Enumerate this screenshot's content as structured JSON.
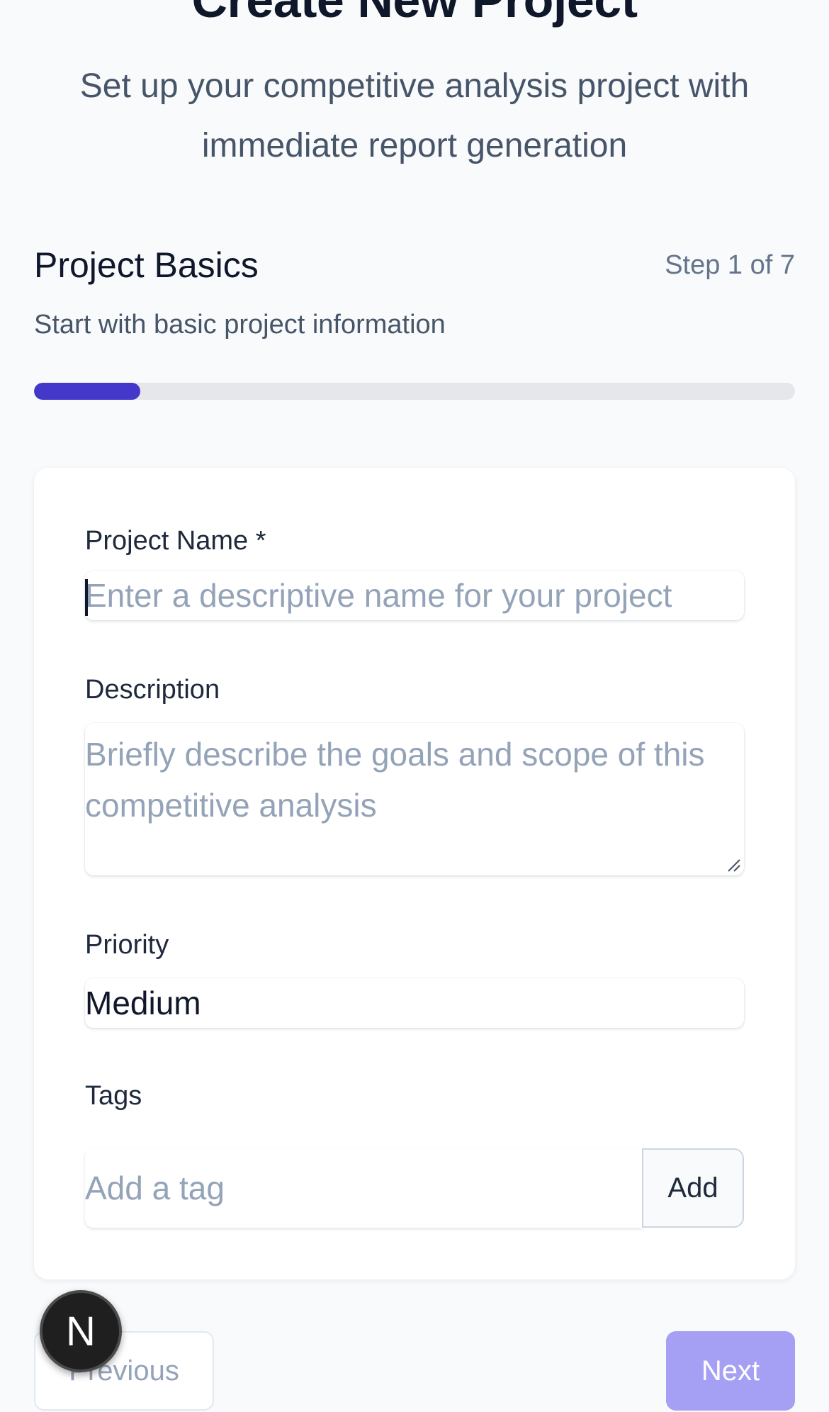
{
  "header": {
    "title": "Create New Project",
    "subtitle": "Set up your competitive analysis project with immediate report generation"
  },
  "step": {
    "title": "Project Basics",
    "counter": "Step 1 of 7",
    "description": "Start with basic project information",
    "progress_fraction": 0.14
  },
  "form": {
    "name_label": "Project Name *",
    "name_placeholder": "Enter a descriptive name for your project",
    "description_label": "Description",
    "description_placeholder": "Briefly describe the goals and scope of this competitive analysis",
    "priority_label": "Priority",
    "priority_value": "Medium",
    "tags_label": "Tags",
    "tags_placeholder": "Add a tag",
    "add_button": "Add"
  },
  "nav": {
    "previous": "Previous",
    "next": "Next"
  },
  "badge": {
    "letter": "N"
  },
  "colors": {
    "accent": "#4338ca",
    "next_disabled": "#a5a0f4"
  }
}
